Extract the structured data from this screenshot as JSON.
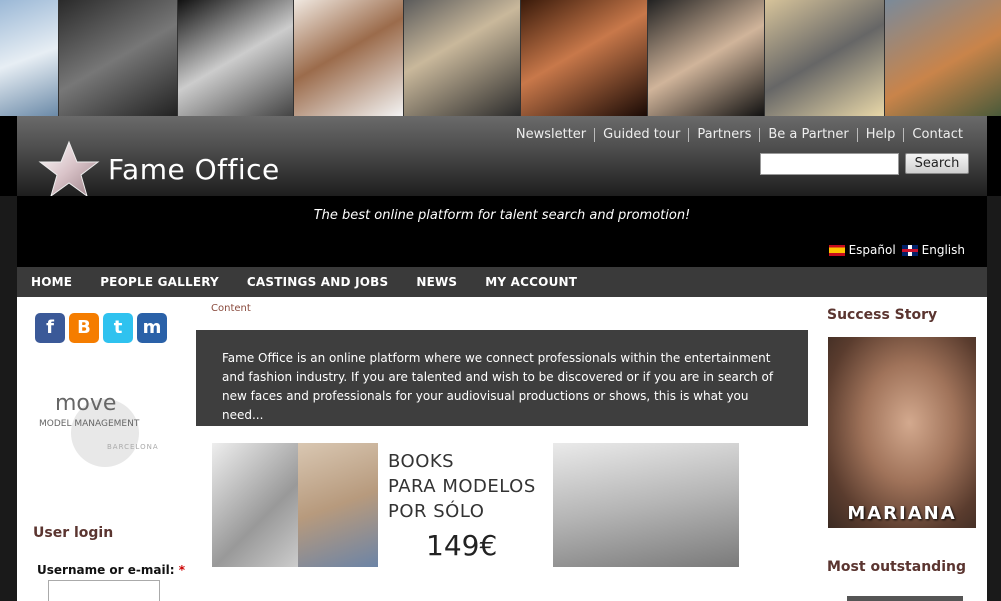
{
  "photo_strip": [
    "model-photo-1",
    "model-photo-2",
    "model-photo-3",
    "model-photo-4",
    "model-photo-5",
    "model-photo-6",
    "model-photo-7",
    "model-photo-8",
    "model-photo-9"
  ],
  "header": {
    "site_name": "Fame Office",
    "top_links": [
      "Newsletter",
      "Guided tour",
      "Partners",
      "Be a Partner",
      "Help",
      "Contact"
    ],
    "search_button": "Search",
    "search_value": ""
  },
  "tagline": "The best online platform for talent search and promotion!",
  "languages": [
    "Español",
    "English"
  ],
  "main_nav": [
    "HOME",
    "PEOPLE GALLERY",
    "CASTINGS AND JOBS",
    "NEWS",
    "MY ACCOUNT"
  ],
  "sidebar": {
    "social": [
      {
        "icon": "facebook-icon",
        "glyph": "f"
      },
      {
        "icon": "blogger-icon",
        "glyph": "B"
      },
      {
        "icon": "twitter-icon",
        "glyph": "t"
      },
      {
        "icon": "myspace-icon",
        "glyph": "m"
      }
    ],
    "partner_logo": {
      "line1": "move",
      "line2": "MODEL MANAGEMENT",
      "line3": "BARCELONA"
    },
    "login_title": "User login",
    "username_label": "Username or e-mail:",
    "required_mark": "*"
  },
  "main": {
    "breadcrumb": "Content",
    "intro": "Fame Office is an online platform where we connect professionals within the entertainment and fashion industry. If you are talented and wish to be discovered or if you are in search of new faces and professionals for your audiovisual productions or shows, this is what you need...",
    "banner": {
      "line1": "BOOKS",
      "line2": "PARA MODELOS",
      "line3": "POR SÓLO",
      "price": "149€"
    }
  },
  "right": {
    "success_title": "Success Story",
    "success_name": "MARIANA",
    "outstanding_title": "Most outstanding"
  },
  "colors": {
    "heading": "#5b3530",
    "nav_bg": "#3a3a3a",
    "intro_bg": "#3e3e3e",
    "breadcrumb": "#8a4b3e"
  }
}
